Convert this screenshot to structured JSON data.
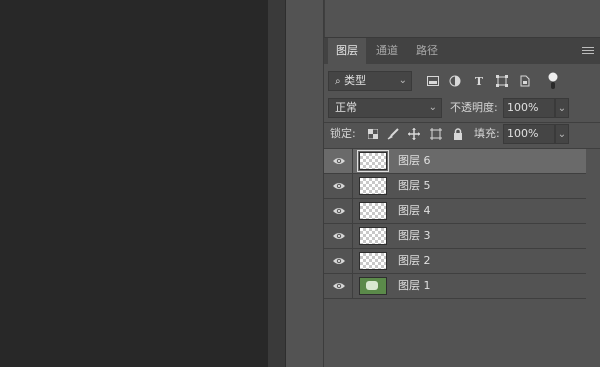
{
  "tabs": [
    {
      "label": "图层",
      "active": true
    },
    {
      "label": "通道",
      "active": false
    },
    {
      "label": "路径",
      "active": false
    }
  ],
  "filter": {
    "kind_label": "类型",
    "icons": [
      "image-filter-icon",
      "adjustment-filter-icon",
      "type-filter-icon",
      "shape-filter-icon",
      "smart-object-filter-icon",
      "filter-toggle-icon"
    ]
  },
  "blend": {
    "mode": "正常",
    "opacity_label": "不透明度:",
    "opacity_value": "100%"
  },
  "lock": {
    "label": "锁定:",
    "fill_label": "填充:",
    "fill_value": "100%",
    "icons": [
      "lock-transparent-pixels-icon",
      "lock-image-pixels-icon",
      "lock-position-icon",
      "lock-artboard-icon",
      "lock-all-icon"
    ]
  },
  "layers": [
    {
      "name": "图层 6",
      "selected": true,
      "thumb": "transparent"
    },
    {
      "name": "图层 5",
      "selected": false,
      "thumb": "transparent"
    },
    {
      "name": "图层 4",
      "selected": false,
      "thumb": "transparent"
    },
    {
      "name": "图层 3",
      "selected": false,
      "thumb": "transparent"
    },
    {
      "name": "图层 2",
      "selected": false,
      "thumb": "transparent"
    },
    {
      "name": "图层 1",
      "selected": false,
      "thumb": "photo"
    }
  ],
  "colors": {
    "panel": "#535353",
    "tabbar": "#424242",
    "selected": "#6a6a6a",
    "canvas": "#282828"
  }
}
